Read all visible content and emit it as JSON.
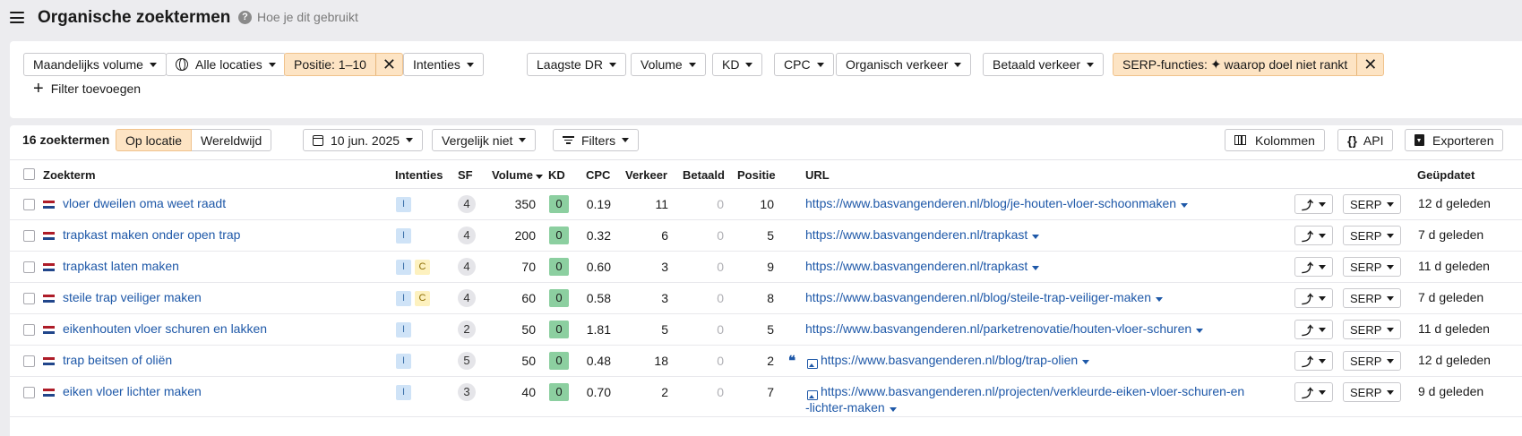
{
  "header": {
    "title": "Organische zoektermen",
    "help_label": "Hoe je dit gebruikt"
  },
  "filters": {
    "monthly_volume": "Maandelijks volume",
    "locations": "Alle locaties",
    "position": "Positie: 1–10",
    "intents": "Intenties",
    "lowest_dr": "Laagste DR",
    "volume": "Volume",
    "kd": "KD",
    "cpc": "CPC",
    "organic_traffic": "Organisch verkeer",
    "paid_traffic": "Betaald verkeer",
    "serp_label": "SERP-functies:",
    "serp_value": "waarop doel niet rankt",
    "add_filter": "Filter toevoegen"
  },
  "toolbar": {
    "count": "16 zoektermen",
    "by_location": "Op locatie",
    "worldwide": "Wereldwijd",
    "date": "10 jun. 2025",
    "compare": "Vergelijk niet",
    "filters": "Filters",
    "columns": "Kolommen",
    "api": "API",
    "export": "Exporteren"
  },
  "table": {
    "columns": {
      "keyword": "Zoekterm",
      "intents": "Intenties",
      "sf": "SF",
      "volume": "Volume",
      "kd": "KD",
      "cpc": "CPC",
      "traffic": "Verkeer",
      "paid": "Betaald",
      "position": "Positie",
      "url": "URL",
      "updated": "Geüpdatet"
    },
    "serp_button": "SERP",
    "rows": [
      {
        "keyword": "vloer dweilen oma weet raadt",
        "intents": [
          "I"
        ],
        "sf": "4",
        "volume": "350",
        "kd": "0",
        "cpc": "0.19",
        "traffic": "11",
        "paid": "0",
        "position": "10",
        "url": "https://www.basvangenderen.nl/blog/je-houten-vloer-schoonmaken",
        "url2": "",
        "quote": false,
        "image": false,
        "updated": "12 d geleden"
      },
      {
        "keyword": "trapkast maken onder open trap",
        "intents": [
          "I"
        ],
        "sf": "4",
        "volume": "200",
        "kd": "0",
        "cpc": "0.32",
        "traffic": "6",
        "paid": "0",
        "position": "5",
        "url": "https://www.basvangenderen.nl/trapkast",
        "url2": "",
        "quote": false,
        "image": false,
        "updated": "7 d geleden"
      },
      {
        "keyword": "trapkast laten maken",
        "intents": [
          "I",
          "C"
        ],
        "sf": "4",
        "volume": "70",
        "kd": "0",
        "cpc": "0.60",
        "traffic": "3",
        "paid": "0",
        "position": "9",
        "url": "https://www.basvangenderen.nl/trapkast",
        "url2": "",
        "quote": false,
        "image": false,
        "updated": "11 d geleden"
      },
      {
        "keyword": "steile trap veiliger maken",
        "intents": [
          "I",
          "C"
        ],
        "sf": "4",
        "volume": "60",
        "kd": "0",
        "cpc": "0.58",
        "traffic": "3",
        "paid": "0",
        "position": "8",
        "url": "https://www.basvangenderen.nl/blog/steile-trap-veiliger-maken",
        "url2": "",
        "quote": false,
        "image": false,
        "updated": "7 d geleden"
      },
      {
        "keyword": "eikenhouten vloer schuren en lakken",
        "intents": [
          "I"
        ],
        "sf": "2",
        "volume": "50",
        "kd": "0",
        "cpc": "1.81",
        "traffic": "5",
        "paid": "0",
        "position": "5",
        "url": "https://www.basvangenderen.nl/parketrenovatie/houten-vloer-schuren",
        "url2": "",
        "quote": false,
        "image": false,
        "updated": "11 d geleden"
      },
      {
        "keyword": "trap beitsen of oliën",
        "intents": [
          "I"
        ],
        "sf": "5",
        "volume": "50",
        "kd": "0",
        "cpc": "0.48",
        "traffic": "18",
        "paid": "0",
        "position": "2",
        "url": "https://www.basvangenderen.nl/blog/trap-olien",
        "url2": "",
        "quote": true,
        "image": true,
        "updated": "12 d geleden"
      },
      {
        "keyword": "eiken vloer lichter maken",
        "intents": [
          "I"
        ],
        "sf": "3",
        "volume": "40",
        "kd": "0",
        "cpc": "0.70",
        "traffic": "2",
        "paid": "0",
        "position": "7",
        "url": "https://www.basvangenderen.nl/projecten/verkleurde-eiken-vloer-schuren-en",
        "url2": "-lichter-maken",
        "quote": false,
        "image": true,
        "updated": "9 d geleden"
      }
    ]
  },
  "colors": {
    "link": "#1e58a8",
    "active_filter": "#fde4c4",
    "kd_green": "#8ccfa0",
    "intent_informational": "#cfe3f7",
    "intent_commercial": "#fdf1bf",
    "flag_red": "#ae1c28",
    "flag_white": "#ffffff",
    "flag_blue": "#21468b"
  }
}
